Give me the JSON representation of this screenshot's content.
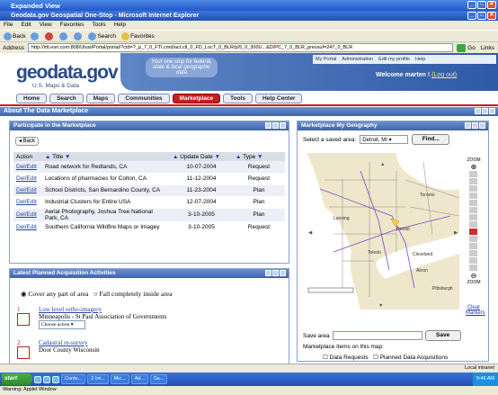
{
  "window": {
    "outer_title": "Expanded View",
    "inner_title": "Geodata.gov Geospatial One-Stop - Microsoft Internet Explorer"
  },
  "menu": [
    "File",
    "Edit",
    "View",
    "Favorites",
    "Tools",
    "Help"
  ],
  "toolbar": {
    "back": "Back",
    "search": "Search",
    "favorites": "Favorites"
  },
  "address": {
    "label": "Address",
    "url": "http://lrtt.esri.com:808/Ulusi/Portal/portal/?ctd=?_p_7_0_FTI.cmd/act.ctl_0_FD_LocT_0_BLR/p/5_0_300U...&D/PC_7_0_BLR_prevsuf=247_0_BLR",
    "go": "Go",
    "links": "Links"
  },
  "header": {
    "logo": "geodata.gov",
    "logo_sub": "U.S. Maps & Data",
    "tagline": "Your one stop for federal, state & local geographic data",
    "portal_links": [
      "My Portal",
      "Administration",
      "Edit my profile",
      "Help"
    ],
    "welcome": "Welcome marten ! ",
    "logout": "(Log out)"
  },
  "nav": [
    "Home",
    "Search",
    "Maps",
    "Communities",
    "Marketplace",
    "Tools",
    "Help Center"
  ],
  "marketplace_bar": "About The Data Marketplace",
  "participate": {
    "title": "Participate in the Marketplace",
    "back": "Back",
    "columns": [
      "Action",
      "Title",
      "Update Date",
      "Type"
    ],
    "rows": [
      {
        "action": "Del/Edit",
        "title": "Road network for Redlands, CA",
        "date": "10-07-2004",
        "type": "Request"
      },
      {
        "action": "Del/Edit",
        "title": "Locations of pharmacies for Colton, CA",
        "date": "11-12-2004",
        "type": "Request"
      },
      {
        "action": "Del/Edit",
        "title": "School Districts, San Bernardino County, CA",
        "date": "11-23-2004",
        "type": "Plan"
      },
      {
        "action": "Del/Edit",
        "title": "Industrial Clusters for Entire USA",
        "date": "12-07-2004",
        "type": "Plan"
      },
      {
        "action": "Del/Edit",
        "title": "Aerial Photography, Joshua Tree National Park, CA",
        "date": "3-10-2005",
        "type": "Plan"
      },
      {
        "action": "Del/Edit",
        "title": "Southern California Wildfire Maps or Imagey",
        "date": "3-10-2005",
        "type": "Request"
      }
    ]
  },
  "planned": {
    "title": "Latest Planned Acquisition Activities",
    "radio1": "Cover any part of area",
    "radio2": "Fall completely inside area",
    "items": [
      {
        "num": "1",
        "title": "Low level ortho-imagery",
        "org": "Minneapolis - St Paul Association of Governments",
        "action": "Choose action"
      },
      {
        "num": "2",
        "title": "Cadastral re-survey",
        "org": "Door County Wisconsin"
      }
    ]
  },
  "geography": {
    "title": "Marketplace My Geography",
    "saved_label": "Select a saved area:",
    "saved_value": "Detroit, MI",
    "find": "Find...",
    "zoom_label": "ZOOM",
    "zoom_level": 8,
    "zoom_steps": 14,
    "cities": [
      "Toronto",
      "Lansing",
      "Detroit",
      "Toledo",
      "Cleveland",
      "Akron",
      "Pittsburgh"
    ],
    "clear_markers": "Clear Markers",
    "save_area": "Save area",
    "save": "Save",
    "items_label": "Marketplace items on this map:",
    "chk1": "Data Requests",
    "chk2": "Planned Data Acquisitions"
  },
  "status": {
    "left": "",
    "zone": "Local intranet"
  },
  "taskbar": {
    "start": "start",
    "tasks": [
      "Conte...",
      "2 Int...",
      "Mic...",
      "Ad...",
      "Sa..."
    ],
    "clock": "9:46 AM"
  },
  "warning": "Warning: Applet Window"
}
